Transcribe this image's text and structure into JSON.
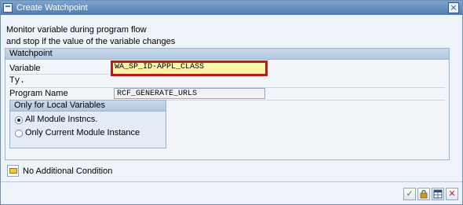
{
  "dialog": {
    "title": "Create Watchpoint",
    "close_icon": "close-icon"
  },
  "intro": {
    "line1": "Monitor variable during program flow",
    "line2": "and stop if the value of the variable changes"
  },
  "watchpoint": {
    "heading": "Watchpoint",
    "variable_label": "Variable",
    "variable_value": "WA_SP_ID-APPL_CLASS",
    "type_label": "Ty.",
    "program_label": "Program Name",
    "program_value": "RCF_GENERATE_URLS"
  },
  "local_vars": {
    "heading": "Only for Local Variables",
    "options": [
      {
        "label": "All Module Instncs.",
        "selected": true
      },
      {
        "label": "Only Current Module Instance",
        "selected": false
      }
    ]
  },
  "condition": {
    "label": "No Additional Condition",
    "icon": "folder-icon"
  },
  "toolbar": {
    "buttons": [
      {
        "name": "confirm-button",
        "icon": "checkmark-icon",
        "color": "#1e9d2a"
      },
      {
        "name": "create-button",
        "icon": "lock-icon",
        "color": "#c79a1e"
      },
      {
        "name": "watchpoints-button",
        "icon": "table-icon",
        "color": "#2b4f84"
      },
      {
        "name": "cancel-button",
        "icon": "cancel-icon",
        "color": "#c81e1e"
      }
    ]
  },
  "colors": {
    "titlebar": "#4f7db0",
    "highlight_border": "#b31d1d",
    "highlight_fill": "#fcf4a6"
  }
}
